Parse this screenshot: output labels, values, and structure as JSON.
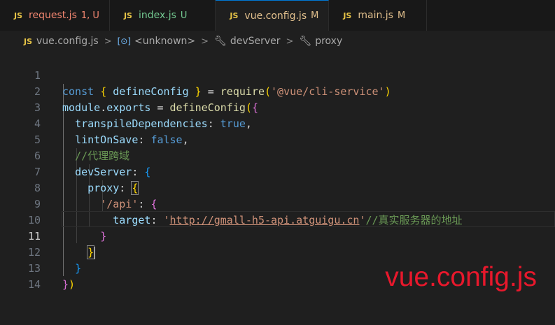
{
  "tabs": [
    {
      "name": "request.js",
      "badge": "1, U",
      "state": "err"
    },
    {
      "name": "index.js",
      "badge": "U",
      "state": "untr"
    },
    {
      "name": "vue.config.js",
      "badge": "M",
      "state": "mod",
      "active": true
    },
    {
      "name": "main.js",
      "badge": "M",
      "state": "mod"
    }
  ],
  "js_icon_label": "JS",
  "breadcrumb": {
    "file": "vue.config.js",
    "unknown": "<unknown>",
    "devServer": "devServer",
    "proxy": "proxy",
    "sep": ">"
  },
  "lines": [
    {
      "no": "1"
    },
    {
      "no": "2"
    },
    {
      "no": "3"
    },
    {
      "no": "4"
    },
    {
      "no": "5"
    },
    {
      "no": "6"
    },
    {
      "no": "7"
    },
    {
      "no": "8"
    },
    {
      "no": "9"
    },
    {
      "no": "10"
    },
    {
      "no": "11"
    },
    {
      "no": "12"
    },
    {
      "no": "13"
    },
    {
      "no": "14"
    }
  ],
  "code": {
    "l1_const": "const",
    "l1_defineConfig": "defineConfig",
    "l1_require": "require",
    "l1_module": "'@vue/cli-service'",
    "l2_module": "module",
    "l2_exports": "exports",
    "l2_fn": "defineConfig",
    "l3_key": "transpileDependencies",
    "l3_val": "true",
    "l4_key": "lintOnSave",
    "l4_val": "false",
    "l5_comment": "//代理跨域",
    "l6_key": "devServer",
    "l7_key": "proxy",
    "l8_key": "'/api'",
    "l9_key": "target",
    "l9_url": "http://gmall-h5-api.atguigu.cn",
    "l9_comment": "//真实服务器的地址"
  },
  "watermark": "vue.config.js",
  "colors": {
    "accent": "#0078d4",
    "watermark": "#e8182c",
    "background": "#1f1f1f"
  }
}
